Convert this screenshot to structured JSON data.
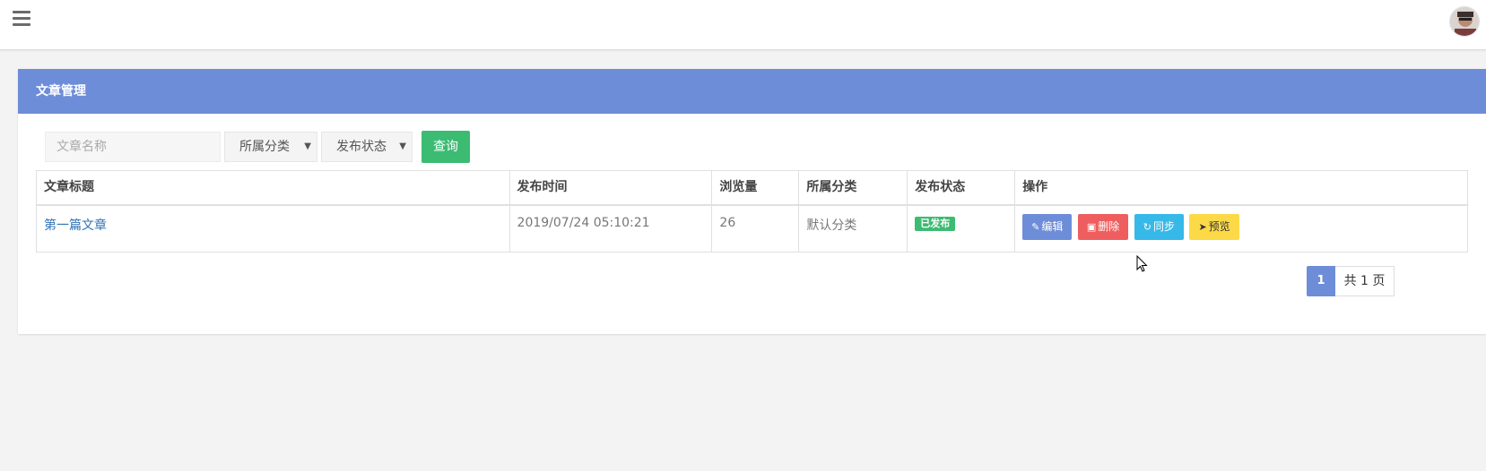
{
  "header": {
    "menu_icon": "hamburger-menu-icon",
    "avatar_icon": "user-avatar"
  },
  "panel": {
    "title": "文章管理"
  },
  "filters": {
    "name_placeholder": "文章名称",
    "category_select": "所属分类",
    "status_select": "发布状态",
    "query_label": "查询"
  },
  "table": {
    "columns": [
      "文章标题",
      "发布时间",
      "浏览量",
      "所属分类",
      "发布状态",
      "操作"
    ],
    "rows": [
      {
        "title": "第一篇文章",
        "publish_time": "2019/07/24 05:10:21",
        "views": "26",
        "category": "默认分类",
        "status": "已发布"
      }
    ],
    "actions": {
      "edit": "编辑",
      "delete": "删除",
      "sync": "同步",
      "preview": "预览"
    }
  },
  "pagination": {
    "current": "1",
    "total": "共 1 页"
  },
  "colors": {
    "primary": "#6e8dd8",
    "success": "#3cbb72",
    "danger": "#ef5e5e",
    "info": "#36b9e8",
    "warning": "#fcd947"
  }
}
